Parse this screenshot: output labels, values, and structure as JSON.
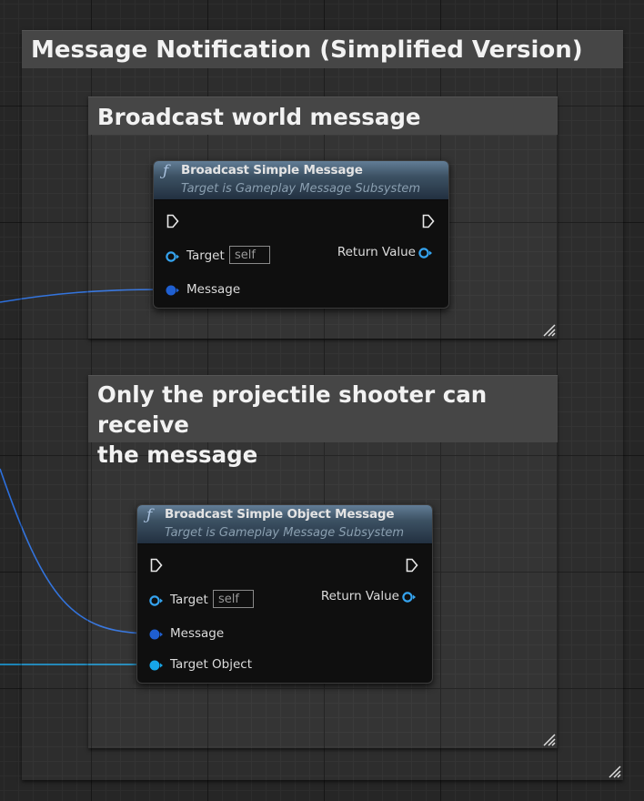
{
  "outer_comment": {
    "title": "Message Notification (Simplified Version)"
  },
  "comment_1": {
    "title": "Broadcast world message"
  },
  "comment_2": {
    "title": "Only the projectile shooter can receive the message",
    "title_line1": "Only the projectile shooter can receive",
    "title_line2": "the message"
  },
  "node_1": {
    "icon": "function-icon",
    "title": "Broadcast Simple Message",
    "subtitle": "Target is Gameplay Message Subsystem",
    "pins": {
      "target": "Target",
      "target_default": "self",
      "message": "Message",
      "return_value": "Return Value"
    }
  },
  "node_2": {
    "icon": "function-icon",
    "title": "Broadcast Simple Object Message",
    "subtitle": "Target is Gameplay Message Subsystem",
    "pins": {
      "target": "Target",
      "target_default": "self",
      "message": "Message",
      "target_object": "Target Object",
      "return_value": "Return Value"
    }
  },
  "colors": {
    "struct_pin": "#1f5fd1",
    "object_pin": "#17a6e8",
    "target_pin": "#35a4f0",
    "header_top": "#627d96",
    "header_bottom": "#223040",
    "comment_header": "#464646"
  }
}
